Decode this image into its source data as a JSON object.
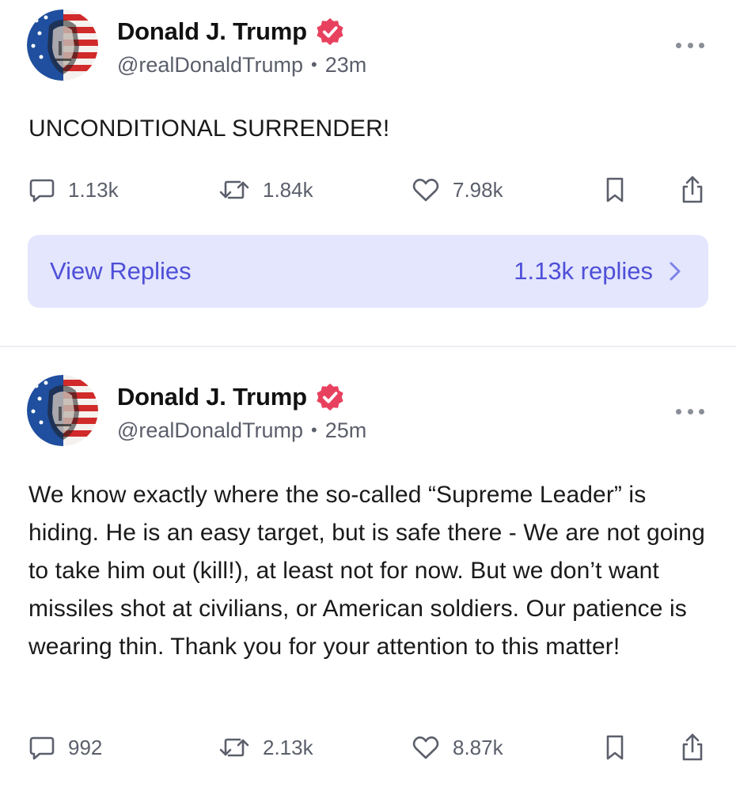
{
  "posts": [
    {
      "author": "Donald J. Trump",
      "handle": "@realDonaldTrump",
      "separator": "•",
      "time": "23m",
      "text": "UNCONDITIONAL SURRENDER!",
      "stats": {
        "replies": "1.13k",
        "retruths": "1.84k",
        "likes": "7.98k"
      },
      "view_replies": {
        "label": "View Replies",
        "count": "1.13k replies"
      }
    },
    {
      "author": "Donald J. Trump",
      "handle": "@realDonaldTrump",
      "separator": "•",
      "time": "25m",
      "text": "We know exactly where the so-called “Supreme Leader” is hiding. He is an easy target, but is safe there - We are not going to take him out (kill!), at least not for now. But we don’t want missiles shot at civilians, or American soldiers. Our patience is wearing thin. Thank you for your attention to this matter!",
      "stats": {
        "replies": "992",
        "retruths": "2.13k",
        "likes": "8.87k"
      }
    }
  ],
  "colors": {
    "verified_badge": "#e8415f",
    "replies_bar_bg": "#e3e6fd",
    "replies_bar_text": "#4f4fd8",
    "meta_text": "#5b5f6b"
  },
  "icons": {
    "verified": "verified-badge-icon",
    "more": "more-options-icon",
    "reply": "speech-bubble-icon",
    "retruth": "retruth-arrows-icon",
    "like": "heart-icon",
    "bookmark": "bookmark-icon",
    "share": "share-icon",
    "chevron": "chevron-right-icon"
  }
}
